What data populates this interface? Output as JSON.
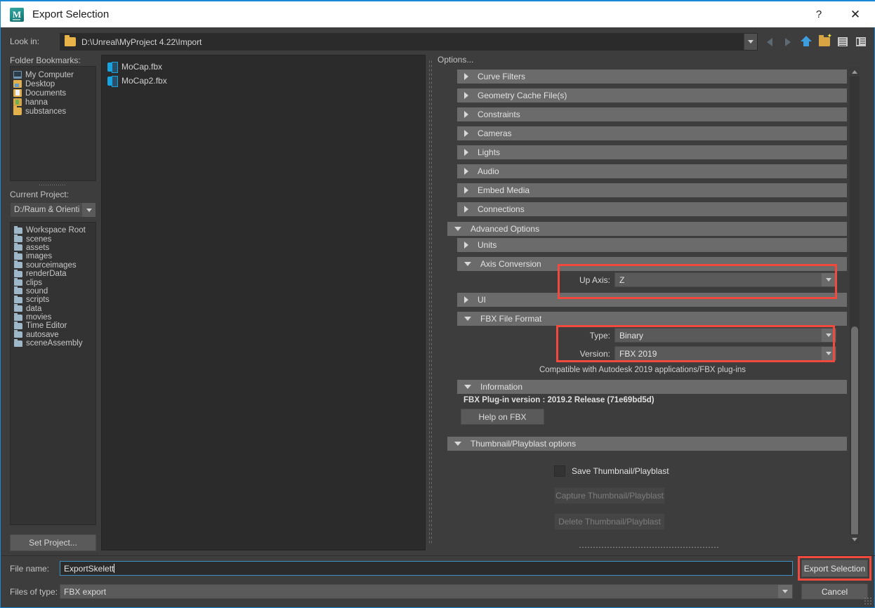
{
  "window": {
    "title": "Export Selection",
    "logo_letter": "M",
    "help_label": "?",
    "close_label": "✕",
    "accent_color": "#1887d6"
  },
  "lookin": {
    "label": "Look in:",
    "path": "D:\\Unreal\\MyProject 4.22\\Import",
    "icons": [
      "back-icon",
      "forward-icon",
      "up-icon",
      "new-folder-icon",
      "list-view-icon",
      "detail-view-icon"
    ]
  },
  "bookmarks": {
    "label": "Folder Bookmarks:",
    "items": [
      {
        "label": "My Computer",
        "icon": "computer-icon"
      },
      {
        "label": "Desktop",
        "icon": "desktop-folder-icon"
      },
      {
        "label": "Documents",
        "icon": "documents-folder-icon"
      },
      {
        "label": "hanna",
        "icon": "user-folder-icon"
      },
      {
        "label": "substances",
        "icon": "folder-icon"
      }
    ]
  },
  "current_project": {
    "label": "Current Project:",
    "value": "D:/Raum & Orienti"
  },
  "project_tree": {
    "items": [
      {
        "label": "Workspace Root"
      },
      {
        "label": "scenes"
      },
      {
        "label": "assets"
      },
      {
        "label": "images"
      },
      {
        "label": "sourceimages"
      },
      {
        "label": "renderData"
      },
      {
        "label": "clips"
      },
      {
        "label": "sound"
      },
      {
        "label": "scripts"
      },
      {
        "label": "data"
      },
      {
        "label": "movies"
      },
      {
        "label": "Time Editor"
      },
      {
        "label": "autosave"
      },
      {
        "label": "sceneAssembly"
      }
    ]
  },
  "set_project_button": "Set Project...",
  "file_list": {
    "files": [
      {
        "name": "MoCap.fbx",
        "icon": "fbx-file-icon"
      },
      {
        "name": "MoCap2.fbx",
        "icon": "fbx-file-icon"
      }
    ]
  },
  "options": {
    "label": "Options...",
    "sections": [
      {
        "label": "Curve Filters",
        "expanded": false
      },
      {
        "label": "Geometry Cache File(s)",
        "expanded": false
      },
      {
        "label": "Constraints",
        "expanded": false
      },
      {
        "label": "Cameras",
        "expanded": false
      },
      {
        "label": "Lights",
        "expanded": false
      },
      {
        "label": "Audio",
        "expanded": false
      },
      {
        "label": "Embed Media",
        "expanded": false
      },
      {
        "label": "Connections",
        "expanded": false
      },
      {
        "label": "Advanced Options",
        "expanded": true
      },
      {
        "label": "Units",
        "expanded": false
      },
      {
        "label": "Axis Conversion",
        "expanded": true
      },
      {
        "label": "UI",
        "expanded": false
      },
      {
        "label": "FBX File Format",
        "expanded": true
      },
      {
        "label": "Information",
        "expanded": true
      },
      {
        "label": "Thumbnail/Playblast options",
        "expanded": true
      }
    ],
    "axis_conversion": {
      "up_axis_label": "Up Axis:",
      "up_axis_value": "Z",
      "highlight_color": "#f2493e"
    },
    "fbx_file_format": {
      "type_label": "Type:",
      "type_value": "Binary",
      "version_label": "Version:",
      "version_value": "FBX 2019",
      "compat_note": "Compatible with Autodesk 2019 applications/FBX plug-ins",
      "highlight_color": "#f2493e"
    },
    "information": {
      "plugin_version": "FBX Plug-in version :  2019.2 Release (71e69bd5d)",
      "help_button": "Help on FBX"
    },
    "thumbnail": {
      "save_checkbox_label": "Save Thumbnail/Playblast",
      "save_checked": false,
      "capture_button": "Capture Thumbnail/Playblast",
      "delete_button": "Delete Thumbnail/Playblast"
    }
  },
  "footer": {
    "file_name_label": "File name:",
    "file_name_value": "ExportSkelett",
    "files_of_type_label": "Files of type:",
    "files_of_type_value": "FBX export",
    "export_button": "Export Selection",
    "cancel_button": "Cancel",
    "export_highlight_color": "#f2493e"
  }
}
